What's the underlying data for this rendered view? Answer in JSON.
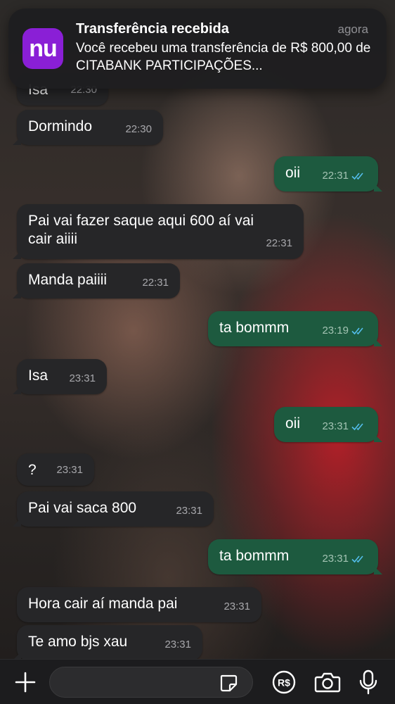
{
  "notification": {
    "app_icon_text": "nu",
    "title": "Transferência recebida",
    "time": "agora",
    "body": "Você recebeu uma transferência de R$ 800,00 de CITABANK PARTICIPAÇÕES..."
  },
  "messages": [
    {
      "dir": "in",
      "text": "Isa",
      "time": "22:30"
    },
    {
      "dir": "in",
      "text": "Dormindo",
      "time": "22:30"
    },
    {
      "dir": "out",
      "text": "oii",
      "time": "22:31",
      "status": "read"
    },
    {
      "dir": "in",
      "text": "Pai vai fazer saque aqui 600 aí vai cair aiiii",
      "time": "22:31"
    },
    {
      "dir": "in",
      "text": "Manda paiiii",
      "time": "22:31"
    },
    {
      "dir": "out",
      "text": "ta bommm",
      "time": "23:19",
      "status": "read"
    },
    {
      "dir": "in",
      "text": "Isa",
      "time": "23:31"
    },
    {
      "dir": "out",
      "text": "oii",
      "time": "23:31",
      "status": "read"
    },
    {
      "dir": "in",
      "text": "?",
      "time": "23:31"
    },
    {
      "dir": "in",
      "text": "Pai vai saca 800",
      "time": "23:31"
    },
    {
      "dir": "out",
      "text": "ta bommm",
      "time": "23:31",
      "status": "read"
    },
    {
      "dir": "in",
      "text": "Hora cair aí manda pai",
      "time": "23:31"
    },
    {
      "dir": "in",
      "text": "Te amo bjs xau",
      "time": "23:31"
    }
  ],
  "input_bar": {
    "message_placeholder": "",
    "icons": [
      "plus-icon",
      "sticker-icon",
      "pix-payment-icon",
      "camera-icon",
      "microphone-icon"
    ],
    "pix_icon_text": "R$"
  },
  "colors": {
    "incoming_bubble": "#262628",
    "outgoing_bubble": "#1d5a3f",
    "read_ticks": "#53bdeb",
    "nubank_purple": "#8a1fd6"
  }
}
